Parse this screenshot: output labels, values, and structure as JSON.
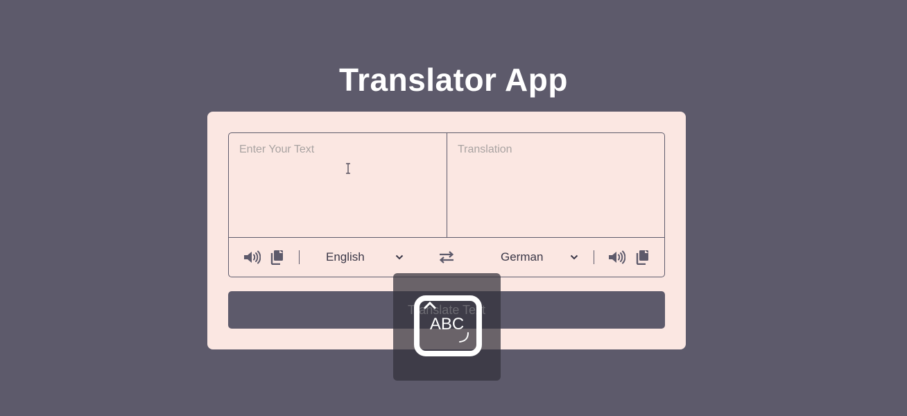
{
  "app": {
    "title": "Translator App"
  },
  "from": {
    "placeholder": "Enter Your Text",
    "value": "",
    "language": "English",
    "speak_icon": "volume-icon",
    "copy_icon": "copy-icon"
  },
  "to": {
    "placeholder": "Translation",
    "value": "",
    "language": "German",
    "speak_icon": "volume-icon",
    "copy_icon": "copy-icon"
  },
  "exchange_icon": "exchange-arrows-icon",
  "button": {
    "label": "Translate Text"
  },
  "overlay": {
    "label": "ABC",
    "icon": "keyboard-input-icon"
  },
  "colors": {
    "background": "#5d5a6b",
    "card": "#fbe7e2",
    "accent": "#5d5a6b",
    "text": "#ffffff"
  }
}
